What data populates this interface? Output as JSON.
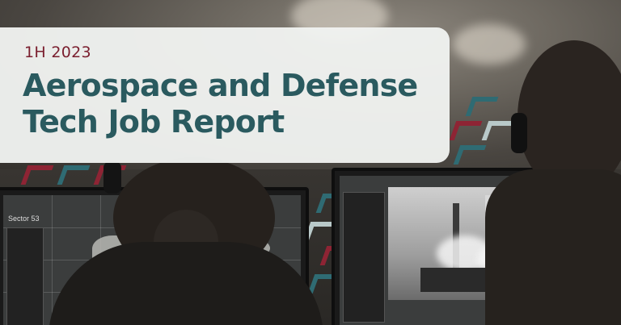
{
  "banner": {
    "eyebrow": "1H 2023",
    "headline_line1": "Aerospace and Defense",
    "headline_line2": "Tech Job Report"
  },
  "colors": {
    "eyebrow": "#7a1e2e",
    "headline": "#2a5a5f",
    "card_background": "#f0f2f0",
    "chevron_red": "#8e2434",
    "chevron_teal": "#2f6b73"
  },
  "photo": {
    "left_screen_label": "Sector 53"
  }
}
